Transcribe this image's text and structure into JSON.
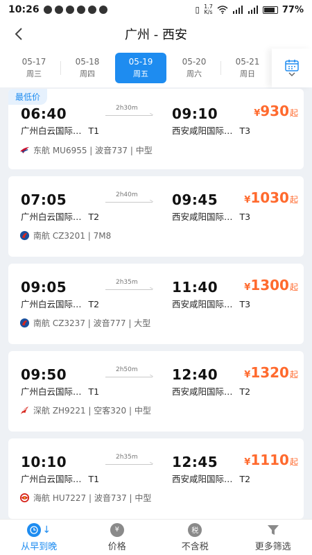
{
  "status_bar": {
    "time": "10:26",
    "speed_top": "1.7",
    "speed_bottom": "K/s",
    "battery": "77%"
  },
  "header": {
    "title": "广州 - 西安"
  },
  "dates": [
    {
      "date": "05-17",
      "weekday": "周三"
    },
    {
      "date": "05-18",
      "weekday": "周四"
    },
    {
      "date": "05-19",
      "weekday": "周五"
    },
    {
      "date": "05-20",
      "weekday": "周六"
    },
    {
      "date": "05-21",
      "weekday": "周日"
    }
  ],
  "lowest_badge": "最低价",
  "flights": [
    {
      "dep_time": "06:40",
      "arr_time": "09:10",
      "duration": "2h30m",
      "dep_airport": "广州白云国际…",
      "dep_terminal": "T1",
      "arr_airport": "西安咸阳国际…",
      "arr_terminal": "T3",
      "yen": "¥",
      "price": "930",
      "price_suffix": "起",
      "airline_info": "东航 MU6955 | 波音737 | 中型",
      "logo": "china-eastern",
      "logo_color": "#c8102e"
    },
    {
      "dep_time": "07:05",
      "arr_time": "09:45",
      "duration": "2h40m",
      "dep_airport": "广州白云国际…",
      "dep_terminal": "T2",
      "arr_airport": "西安咸阳国际…",
      "arr_terminal": "T3",
      "yen": "¥",
      "price": "1030",
      "price_suffix": "起",
      "airline_info": "南航 CZ3201 | 7M8",
      "logo": "china-southern",
      "logo_color": "#1b4f9c"
    },
    {
      "dep_time": "09:05",
      "arr_time": "11:40",
      "duration": "2h35m",
      "dep_airport": "广州白云国际…",
      "dep_terminal": "T2",
      "arr_airport": "西安咸阳国际…",
      "arr_terminal": "T3",
      "yen": "¥",
      "price": "1300",
      "price_suffix": "起",
      "airline_info": "南航 CZ3237 | 波音777 | 大型",
      "logo": "china-southern",
      "logo_color": "#1b4f9c"
    },
    {
      "dep_time": "09:50",
      "arr_time": "12:40",
      "duration": "2h50m",
      "dep_airport": "广州白云国际…",
      "dep_terminal": "T1",
      "arr_airport": "西安咸阳国际…",
      "arr_terminal": "T2",
      "yen": "¥",
      "price": "1320",
      "price_suffix": "起",
      "airline_info": "深航 ZH9221 | 空客320 | 中型",
      "logo": "shenzhen-airlines",
      "logo_color": "#d7261e"
    },
    {
      "dep_time": "10:10",
      "arr_time": "12:45",
      "duration": "2h35m",
      "dep_airport": "广州白云国际…",
      "dep_terminal": "T1",
      "arr_airport": "西安咸阳国际…",
      "arr_terminal": "T2",
      "yen": "¥",
      "price": "1110",
      "price_suffix": "起",
      "airline_info": "海航 HU7227 | 波音737 | 中型",
      "logo": "hainan-airlines",
      "logo_color": "#d7261e"
    }
  ],
  "bottom_bar": {
    "sort_early_to_late": "从早到晚",
    "price": "价格",
    "price_icon": "¥",
    "no_tax": "不含税",
    "no_tax_icon": "税",
    "more_filters": "更多筛选"
  },
  "colors": {
    "accent": "#1e8cf0",
    "price": "#ff6a2e"
  }
}
